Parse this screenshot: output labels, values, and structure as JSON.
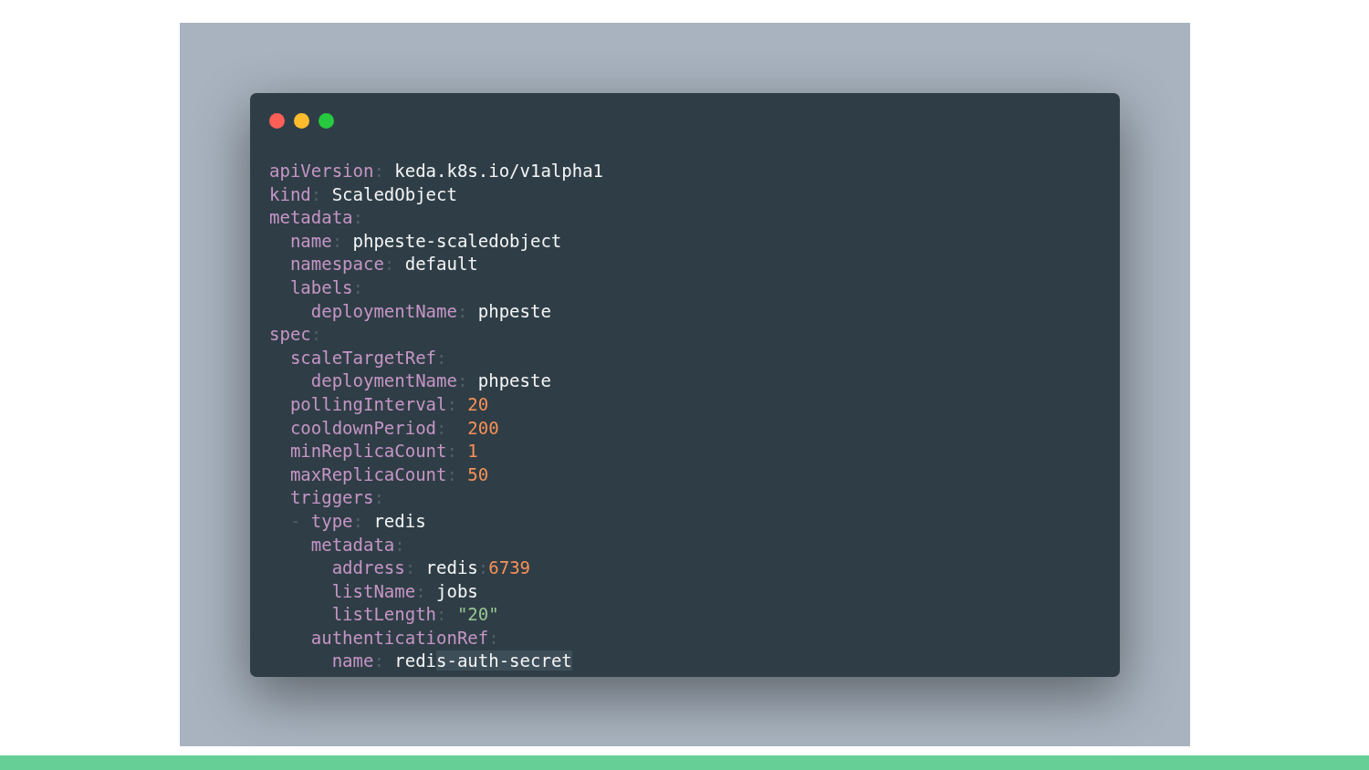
{
  "code_window": {
    "lines": [
      [
        {
          "kind": "key",
          "text": "apiVersion"
        },
        {
          "kind": "colon",
          "text": ": "
        },
        {
          "kind": "string",
          "text": "keda.k8s.io/v1alpha1"
        }
      ],
      [
        {
          "kind": "key",
          "text": "kind"
        },
        {
          "kind": "colon",
          "text": ": "
        },
        {
          "kind": "string",
          "text": "ScaledObject"
        }
      ],
      [
        {
          "kind": "key",
          "text": "metadata"
        },
        {
          "kind": "colon",
          "text": ":"
        }
      ],
      [
        {
          "kind": "key",
          "text": "  name"
        },
        {
          "kind": "colon",
          "text": ": "
        },
        {
          "kind": "string",
          "text": "phpeste-scaledobject"
        }
      ],
      [
        {
          "kind": "key",
          "text": "  namespace"
        },
        {
          "kind": "colon",
          "text": ": "
        },
        {
          "kind": "string",
          "text": "default"
        }
      ],
      [
        {
          "kind": "key",
          "text": "  labels"
        },
        {
          "kind": "colon",
          "text": ":"
        }
      ],
      [
        {
          "kind": "key",
          "text": "    deploymentName"
        },
        {
          "kind": "colon",
          "text": ": "
        },
        {
          "kind": "string",
          "text": "phpeste"
        }
      ],
      [
        {
          "kind": "key",
          "text": "spec"
        },
        {
          "kind": "colon",
          "text": ":"
        }
      ],
      [
        {
          "kind": "key",
          "text": "  scaleTargetRef"
        },
        {
          "kind": "colon",
          "text": ":"
        }
      ],
      [
        {
          "kind": "key",
          "text": "    deploymentName"
        },
        {
          "kind": "colon",
          "text": ": "
        },
        {
          "kind": "string",
          "text": "phpeste"
        }
      ],
      [
        {
          "kind": "key",
          "text": "  pollingInterval"
        },
        {
          "kind": "colon",
          "text": ": "
        },
        {
          "kind": "number",
          "text": "20"
        }
      ],
      [
        {
          "kind": "key",
          "text": "  cooldownPeriod"
        },
        {
          "kind": "colon",
          "text": ":  "
        },
        {
          "kind": "number",
          "text": "200"
        }
      ],
      [
        {
          "kind": "key",
          "text": "  minReplicaCount"
        },
        {
          "kind": "colon",
          "text": ": "
        },
        {
          "kind": "number",
          "text": "1"
        }
      ],
      [
        {
          "kind": "key",
          "text": "  maxReplicaCount"
        },
        {
          "kind": "colon",
          "text": ": "
        },
        {
          "kind": "number",
          "text": "50"
        }
      ],
      [
        {
          "kind": "key",
          "text": "  triggers"
        },
        {
          "kind": "colon",
          "text": ":"
        }
      ],
      [
        {
          "kind": "colon",
          "text": "  - "
        },
        {
          "kind": "key",
          "text": "type"
        },
        {
          "kind": "colon",
          "text": ": "
        },
        {
          "kind": "string",
          "text": "redis"
        }
      ],
      [
        {
          "kind": "key",
          "text": "    metadata"
        },
        {
          "kind": "colon",
          "text": ":"
        }
      ],
      [
        {
          "kind": "key",
          "text": "      address"
        },
        {
          "kind": "colon",
          "text": ": "
        },
        {
          "kind": "string",
          "text": "redis"
        },
        {
          "kind": "colon",
          "text": ":"
        },
        {
          "kind": "number",
          "text": "6739"
        }
      ],
      [
        {
          "kind": "key",
          "text": "      listName"
        },
        {
          "kind": "colon",
          "text": ": "
        },
        {
          "kind": "string",
          "text": "jobs"
        }
      ],
      [
        {
          "kind": "key",
          "text": "      listLength"
        },
        {
          "kind": "colon",
          "text": ": "
        },
        {
          "kind": "quoted",
          "text": "\"20\""
        }
      ],
      [
        {
          "kind": "key",
          "text": "    authenticationRef"
        },
        {
          "kind": "colon",
          "text": ":"
        }
      ],
      [
        {
          "kind": "key",
          "text": "      name"
        },
        {
          "kind": "colon",
          "text": ": "
        },
        {
          "kind": "string",
          "text": "redi"
        },
        {
          "kind": "selected",
          "text": "s-auth-secret"
        }
      ]
    ]
  }
}
